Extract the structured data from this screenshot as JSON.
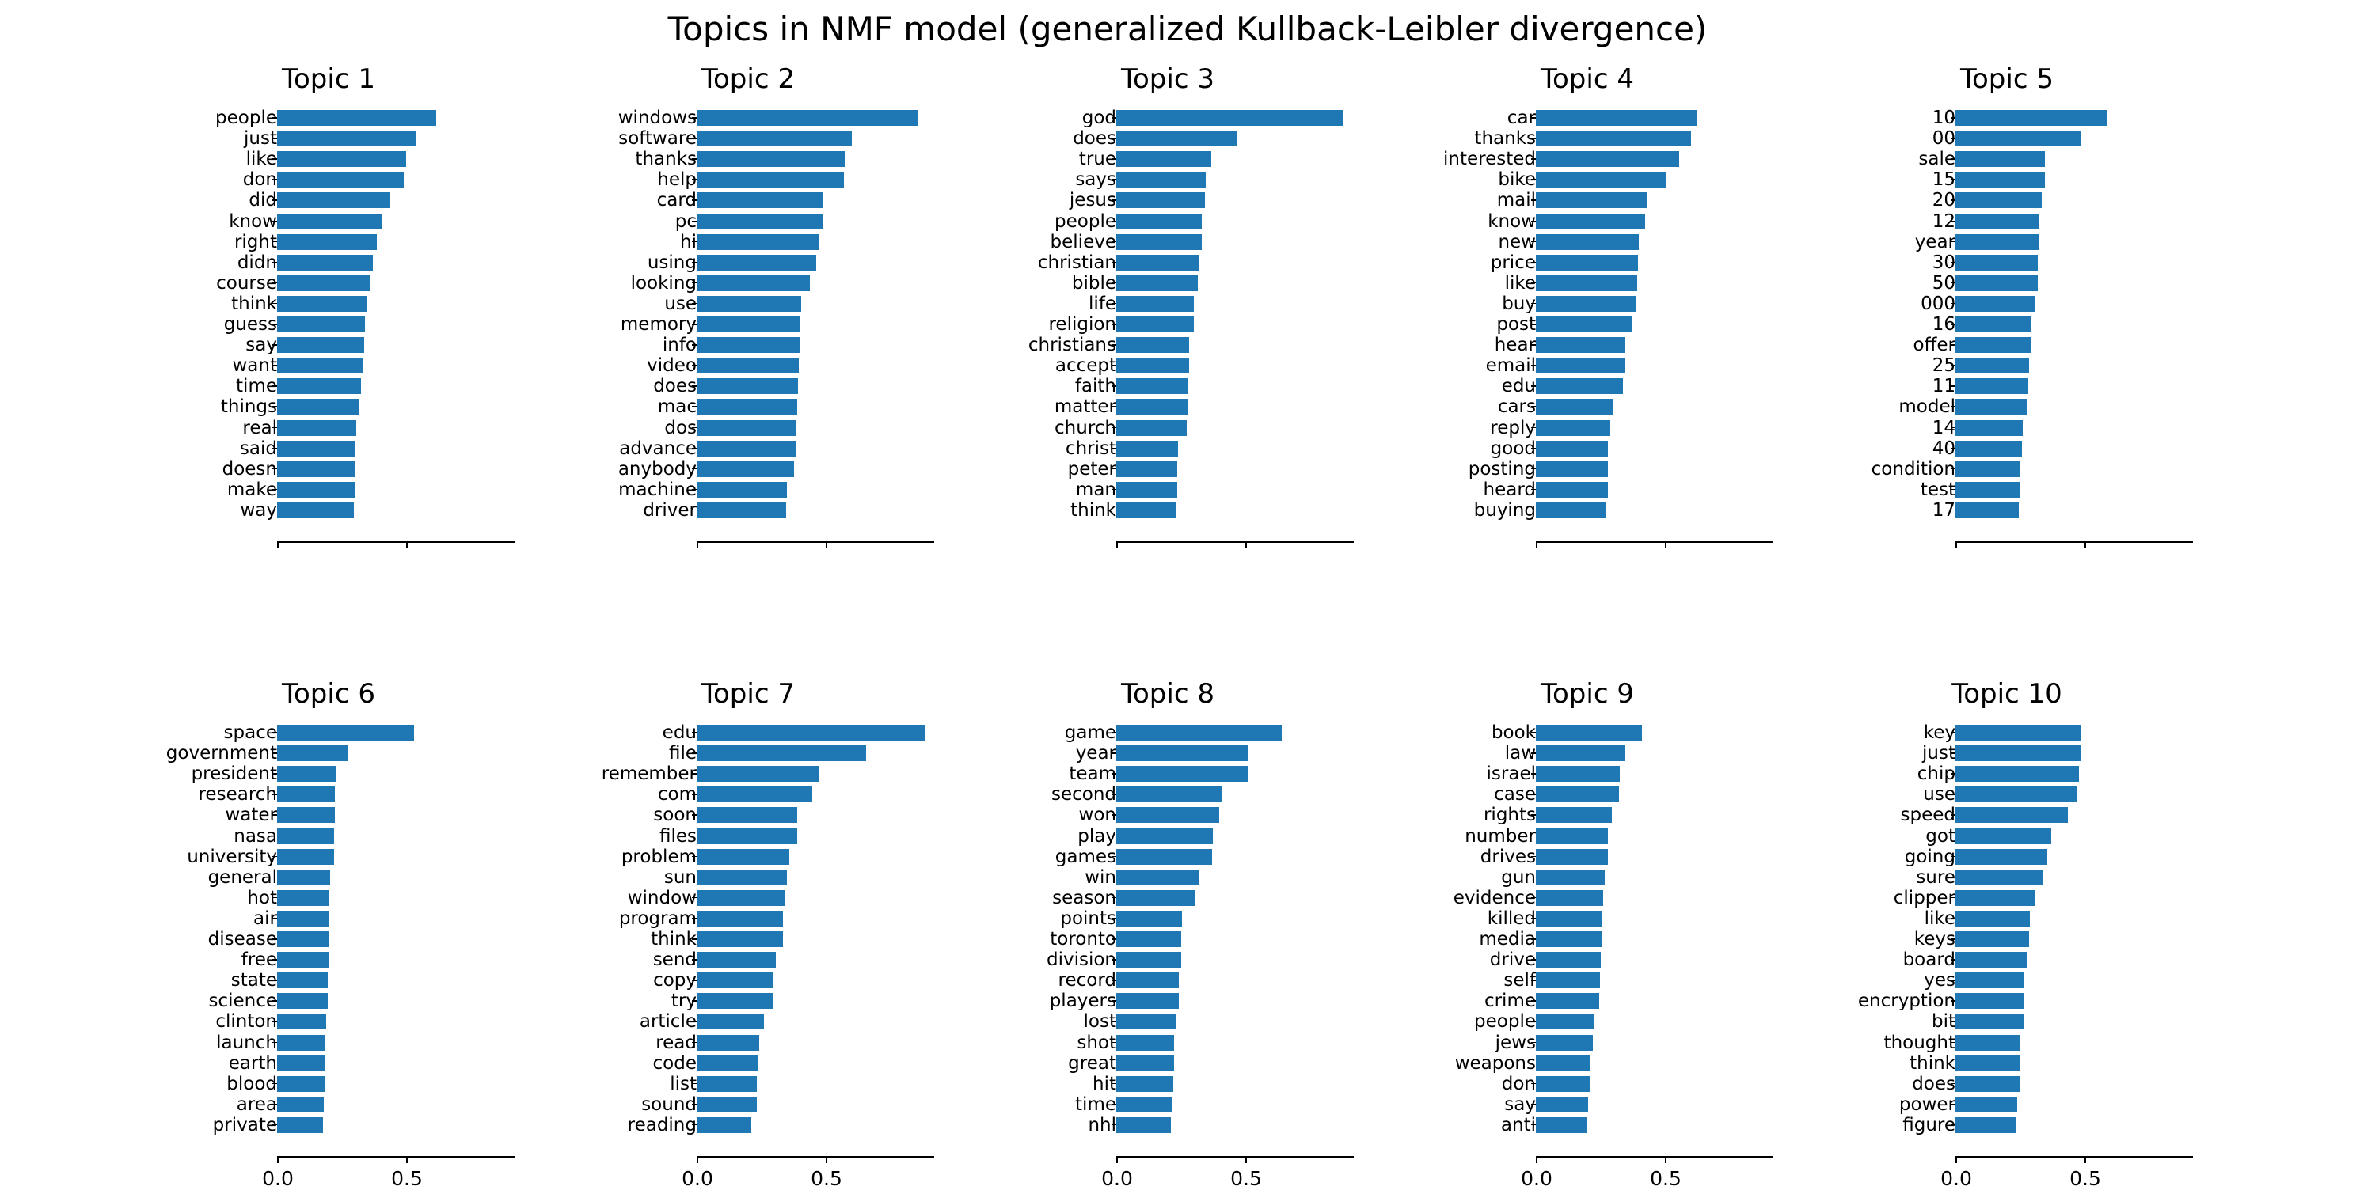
{
  "figure": {
    "suptitle": "Topics in NMF model (generalized Kullback-Leibler divergence)",
    "bar_color": "#1f77b4",
    "background": "#ffffff"
  },
  "chart_data": {
    "type": "bar",
    "orientation": "horizontal",
    "title": "Topics in NMF model (generalized Kullback-Leibler divergence)",
    "xlabel": "",
    "ylabel": "",
    "xlim": [
      0.0,
      0.92
    ],
    "xticks": [
      0.0,
      0.5
    ],
    "xticklabels": [
      "0.0",
      "0.5"
    ],
    "grid": false,
    "legend": null,
    "layout": {
      "rows": 2,
      "cols": 5
    },
    "color": "#1f77b4",
    "note": "Top-row subplots share the x axis with the bottom row; only the bottom row shows tick labels.",
    "subplots": [
      {
        "title": "Topic 1",
        "show_xticklabels": false,
        "categories": [
          "people",
          "just",
          "like",
          "don",
          "did",
          "know",
          "right",
          "didn",
          "course",
          "think",
          "guess",
          "say",
          "want",
          "time",
          "things",
          "real",
          "said",
          "doesn",
          "make",
          "way"
        ],
        "values": [
          0.615,
          0.54,
          0.5,
          0.49,
          0.44,
          0.405,
          0.385,
          0.37,
          0.36,
          0.348,
          0.34,
          0.338,
          0.33,
          0.325,
          0.315,
          0.308,
          0.305,
          0.303,
          0.3,
          0.298
        ]
      },
      {
        "title": "Topic 2",
        "show_xticklabels": false,
        "categories": [
          "windows",
          "software",
          "thanks",
          "help",
          "card",
          "pc",
          "hi",
          "using",
          "looking",
          "use",
          "memory",
          "info",
          "video",
          "does",
          "mac",
          "dos",
          "advance",
          "anybody",
          "machine",
          "driver"
        ],
        "values": [
          0.86,
          0.6,
          0.573,
          0.57,
          0.49,
          0.488,
          0.475,
          0.463,
          0.44,
          0.405,
          0.403,
          0.4,
          0.395,
          0.392,
          0.388,
          0.385,
          0.385,
          0.378,
          0.35,
          0.348
        ]
      },
      {
        "title": "Topic 3",
        "show_xticklabels": false,
        "categories": [
          "god",
          "does",
          "true",
          "says",
          "jesus",
          "people",
          "believe",
          "christian",
          "bible",
          "life",
          "religion",
          "christians",
          "accept",
          "faith",
          "matter",
          "church",
          "christ",
          "peter",
          "man",
          "think"
        ],
        "values": [
          0.88,
          0.465,
          0.368,
          0.345,
          0.343,
          0.33,
          0.33,
          0.322,
          0.317,
          0.3,
          0.3,
          0.283,
          0.283,
          0.278,
          0.275,
          0.272,
          0.238,
          0.237,
          0.235,
          0.233
        ]
      },
      {
        "title": "Topic 4",
        "show_xticklabels": false,
        "categories": [
          "car",
          "thanks",
          "interested",
          "bike",
          "mail",
          "know",
          "new",
          "price",
          "like",
          "buy",
          "post",
          "hear",
          "email",
          "edu",
          "cars",
          "reply",
          "good",
          "posting",
          "heard",
          "buying"
        ],
        "values": [
          0.625,
          0.6,
          0.555,
          0.505,
          0.43,
          0.422,
          0.4,
          0.395,
          0.393,
          0.385,
          0.375,
          0.348,
          0.345,
          0.338,
          0.3,
          0.288,
          0.28,
          0.28,
          0.28,
          0.273
        ]
      },
      {
        "title": "Topic 5",
        "show_xticklabels": false,
        "categories": [
          "10",
          "00",
          "sale",
          "15",
          "20",
          "12",
          "year",
          "30",
          "50",
          "000",
          "16",
          "offer",
          "25",
          "11",
          "model",
          "14",
          "40",
          "condition",
          "test",
          "17"
        ],
        "values": [
          0.59,
          0.488,
          0.345,
          0.345,
          0.335,
          0.325,
          0.322,
          0.32,
          0.318,
          0.31,
          0.295,
          0.293,
          0.285,
          0.282,
          0.278,
          0.26,
          0.258,
          0.25,
          0.248,
          0.245
        ]
      },
      {
        "title": "Topic 6",
        "show_xticklabels": true,
        "categories": [
          "space",
          "government",
          "president",
          "research",
          "water",
          "nasa",
          "university",
          "general",
          "hot",
          "air",
          "disease",
          "free",
          "state",
          "science",
          "clinton",
          "launch",
          "earth",
          "blood",
          "area",
          "private"
        ],
        "values": [
          0.53,
          0.273,
          0.228,
          0.225,
          0.223,
          0.222,
          0.22,
          0.205,
          0.203,
          0.202,
          0.2,
          0.198,
          0.197,
          0.197,
          0.19,
          0.188,
          0.187,
          0.186,
          0.18,
          0.178
        ]
      },
      {
        "title": "Topic 7",
        "show_xticklabels": true,
        "categories": [
          "edu",
          "file",
          "remember",
          "com",
          "soon",
          "files",
          "problem",
          "sun",
          "window",
          "program",
          "think",
          "send",
          "copy",
          "try",
          "article",
          "read",
          "code",
          "list",
          "sound",
          "reading"
        ],
        "values": [
          0.885,
          0.655,
          0.473,
          0.448,
          0.39,
          0.39,
          0.358,
          0.35,
          0.342,
          0.335,
          0.333,
          0.308,
          0.295,
          0.293,
          0.262,
          0.242,
          0.24,
          0.232,
          0.232,
          0.212
        ]
      },
      {
        "title": "Topic 8",
        "show_xticklabels": true,
        "categories": [
          "game",
          "year",
          "team",
          "second",
          "won",
          "play",
          "games",
          "win",
          "season",
          "points",
          "toronto",
          "division",
          "record",
          "players",
          "lost",
          "shot",
          "great",
          "hit",
          "time",
          "nhl"
        ],
        "values": [
          0.64,
          0.513,
          0.51,
          0.408,
          0.4,
          0.373,
          0.372,
          0.32,
          0.303,
          0.255,
          0.25,
          0.25,
          0.243,
          0.243,
          0.233,
          0.225,
          0.225,
          0.22,
          0.218,
          0.212
        ]
      },
      {
        "title": "Topic 9",
        "show_xticklabels": true,
        "categories": [
          "book",
          "law",
          "israel",
          "case",
          "rights",
          "number",
          "drives",
          "gun",
          "evidence",
          "killed",
          "media",
          "drive",
          "self",
          "crime",
          "people",
          "jews",
          "weapons",
          "don",
          "say",
          "anti"
        ],
        "values": [
          0.41,
          0.348,
          0.325,
          0.323,
          0.295,
          0.28,
          0.278,
          0.268,
          0.262,
          0.258,
          0.255,
          0.252,
          0.248,
          0.245,
          0.225,
          0.222,
          0.21,
          0.208,
          0.203,
          0.195
        ]
      },
      {
        "title": "Topic 10",
        "show_xticklabels": true,
        "categories": [
          "key",
          "just",
          "chip",
          "use",
          "speed",
          "got",
          "going",
          "sure",
          "clipper",
          "like",
          "keys",
          "board",
          "yes",
          "encryption",
          "bit",
          "thought",
          "think",
          "does",
          "power",
          "figure"
        ],
        "values": [
          0.485,
          0.483,
          0.478,
          0.472,
          0.435,
          0.37,
          0.355,
          0.337,
          0.31,
          0.288,
          0.285,
          0.278,
          0.268,
          0.268,
          0.265,
          0.252,
          0.248,
          0.248,
          0.24,
          0.235
        ]
      }
    ]
  }
}
